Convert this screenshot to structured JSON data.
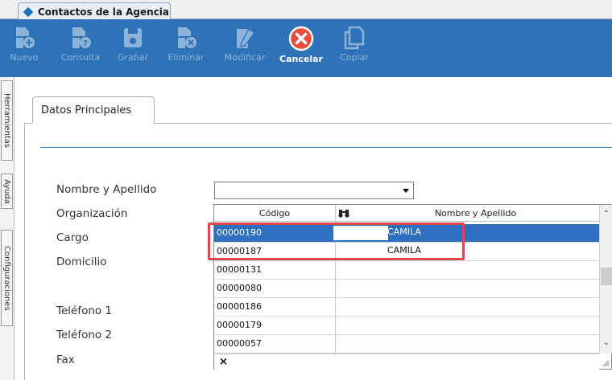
{
  "window": {
    "tab_title": "Contactos de la Agencia"
  },
  "toolbar": {
    "buttons": [
      {
        "label": "Nuevo",
        "icon": "document-add-icon",
        "active": false
      },
      {
        "label": "Consulta",
        "icon": "document-help-icon",
        "active": false
      },
      {
        "label": "Grabar",
        "icon": "save-icon",
        "active": false
      },
      {
        "label": "Eliminar",
        "icon": "document-delete-icon",
        "active": false
      },
      {
        "label": "Modificar",
        "icon": "document-edit-icon",
        "active": false
      },
      {
        "label": "Cancelar",
        "icon": "cancel-icon",
        "active": true
      },
      {
        "label": "Copiar",
        "icon": "copy-icon",
        "active": false
      }
    ]
  },
  "sidebar": {
    "tabs": [
      "Herramientas",
      "Ayuda",
      "Configuraciones"
    ]
  },
  "form": {
    "tab_label": "Datos Principales",
    "labels": {
      "nombre": "Nombre y Apellido",
      "organizacion": "Organización",
      "cargo": "Cargo",
      "domicilio": "Domicilio",
      "telefono1": "Teléfono 1",
      "telefono2": "Teléfono 2",
      "fax": "Fax"
    },
    "nombre_value": ""
  },
  "dropdown": {
    "columns": [
      "Código",
      "Nombre y Apellido"
    ],
    "rows": [
      {
        "codigo": "00000190",
        "nombre": "CAMILA",
        "selected": true
      },
      {
        "codigo": "00000187",
        "nombre": "CAMILA",
        "selected": false
      },
      {
        "codigo": "00000131",
        "nombre": "",
        "selected": false
      },
      {
        "codigo": "00000080",
        "nombre": "",
        "selected": false
      },
      {
        "codigo": "00000186",
        "nombre": "",
        "selected": false
      },
      {
        "codigo": "00000179",
        "nombre": "",
        "selected": false
      },
      {
        "codigo": "00000057",
        "nombre": "",
        "selected": false
      }
    ],
    "footer_symbol": "×"
  },
  "colors": {
    "toolbar_bg": "#2e73b8",
    "selection": "#2f6fc1",
    "highlight_border": "#e0474c",
    "cancel_icon": "#e94b3c"
  }
}
